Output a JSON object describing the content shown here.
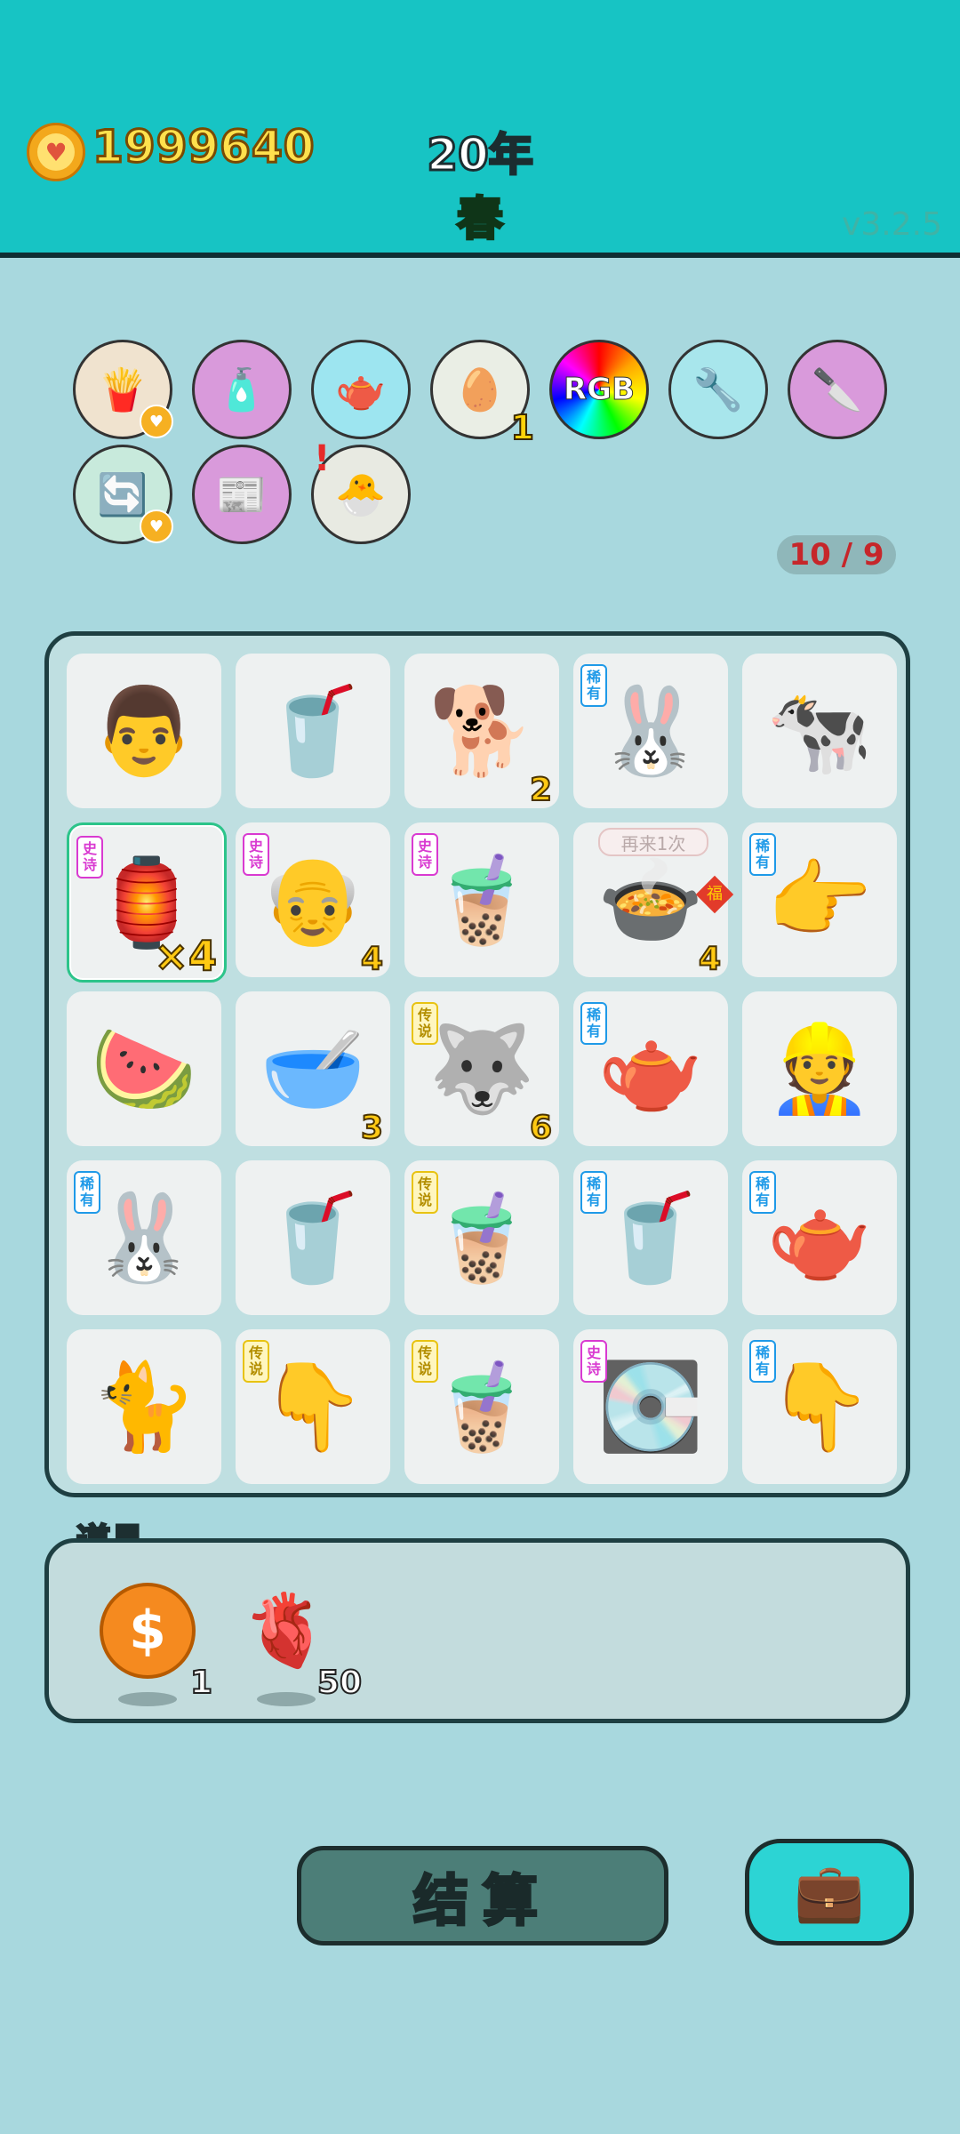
{
  "header": {
    "coins": "1999640",
    "year": "20年",
    "season": "春",
    "version": "v3.2.5"
  },
  "tools": [
    {
      "name": "fries-icon",
      "bg": "#f0e3cf",
      "glyph": "🍟",
      "heart": true
    },
    {
      "name": "spray-bottle-icon",
      "bg": "#d99adb",
      "glyph": "🧴"
    },
    {
      "name": "gravy-boat-icon",
      "bg": "#9de5f0",
      "glyph": "🫖"
    },
    {
      "name": "egg-tray-icon",
      "bg": "#eaeee5",
      "glyph": "🥚",
      "badge": "1"
    },
    {
      "name": "rgb-wheel-icon",
      "bg": "conic-gradient(red,orange,yellow,lime,cyan,blue,magenta,red)",
      "glyph": "RGB"
    },
    {
      "name": "pump-icon",
      "bg": "#a8e6ec",
      "glyph": "🔧"
    },
    {
      "name": "cleaver-icon",
      "bg": "#d99adb",
      "glyph": "🔪"
    },
    {
      "name": "refresh-icon",
      "bg": "#c8eadc",
      "glyph": "🔄",
      "heart": true
    },
    {
      "name": "time-magazine-icon",
      "bg": "#d99adb",
      "glyph": "📰"
    },
    {
      "name": "chick-egg-icon",
      "bg": "#e8eae2",
      "glyph": "🐣",
      "excl": "!"
    }
  ],
  "progress": "10 / 9",
  "board": [
    {
      "glyph": "👨",
      "name": "man-face"
    },
    {
      "glyph": "🥤",
      "name": "small-milk-tea"
    },
    {
      "glyph": "🐕",
      "name": "husky-dog",
      "count": "2"
    },
    {
      "glyph": "🐰",
      "name": "rabbit",
      "tag": "稀有",
      "tagType": "rare"
    },
    {
      "glyph": "🐄",
      "name": "cow"
    },
    {
      "glyph": "🏮",
      "name": "rabbit-tent",
      "tag": "史诗",
      "tagType": "epic",
      "count": "×4",
      "big": true,
      "selected": true
    },
    {
      "glyph": "👴",
      "name": "old-man-face",
      "tag": "史诗",
      "tagType": "epic",
      "count": "4"
    },
    {
      "glyph": "🧋",
      "name": "large-milk-tea",
      "tag": "史诗",
      "tagType": "epic"
    },
    {
      "glyph": "🍲",
      "name": "soup-bowl",
      "count": "4",
      "bubble": "再来1次",
      "fu": "福"
    },
    {
      "glyph": "👉",
      "name": "pointing-hand",
      "tag": "稀有",
      "tagType": "rare"
    },
    {
      "glyph": "🍉",
      "name": "watermelon"
    },
    {
      "glyph": "🥣",
      "name": "bowl",
      "count": "3"
    },
    {
      "glyph": "🐺",
      "name": "king-husky",
      "tag": "传说",
      "tagType": "legend",
      "count": "6"
    },
    {
      "glyph": "🫖",
      "name": "teapot",
      "tag": "稀有",
      "tagType": "rare"
    },
    {
      "glyph": "👷",
      "name": "worker-face"
    },
    {
      "glyph": "🐰",
      "name": "rabbit",
      "tag": "稀有",
      "tagType": "rare"
    },
    {
      "glyph": "🥤",
      "name": "small-milk-tea"
    },
    {
      "glyph": "🧋",
      "name": "domed-milk-tea",
      "tag": "传说",
      "tagType": "legend"
    },
    {
      "glyph": "🥤",
      "name": "milk-tea-cup",
      "tag": "稀有",
      "tagType": "rare"
    },
    {
      "glyph": "🫖",
      "name": "teapot",
      "tag": "稀有",
      "tagType": "rare"
    },
    {
      "glyph": "🐈",
      "name": "cat"
    },
    {
      "glyph": "👇",
      "name": "yellow-hand",
      "tag": "传说",
      "tagType": "legend"
    },
    {
      "glyph": "🧋",
      "name": "domed-milk-tea",
      "tag": "传说",
      "tagType": "legend"
    },
    {
      "glyph": "💽",
      "name": "gpu-card",
      "tag": "史诗",
      "tagType": "epic"
    },
    {
      "glyph": "👇",
      "name": "brown-hand",
      "tag": "稀有",
      "tagType": "rare"
    }
  ],
  "props": {
    "label": "道具",
    "items": [
      {
        "name": "dollar-coin",
        "glyph": "$",
        "count": "1"
      },
      {
        "name": "liver",
        "glyph": "🫀",
        "count": "50"
      }
    ]
  },
  "buttons": {
    "settle": "结算",
    "bag_glyph": "💼"
  }
}
